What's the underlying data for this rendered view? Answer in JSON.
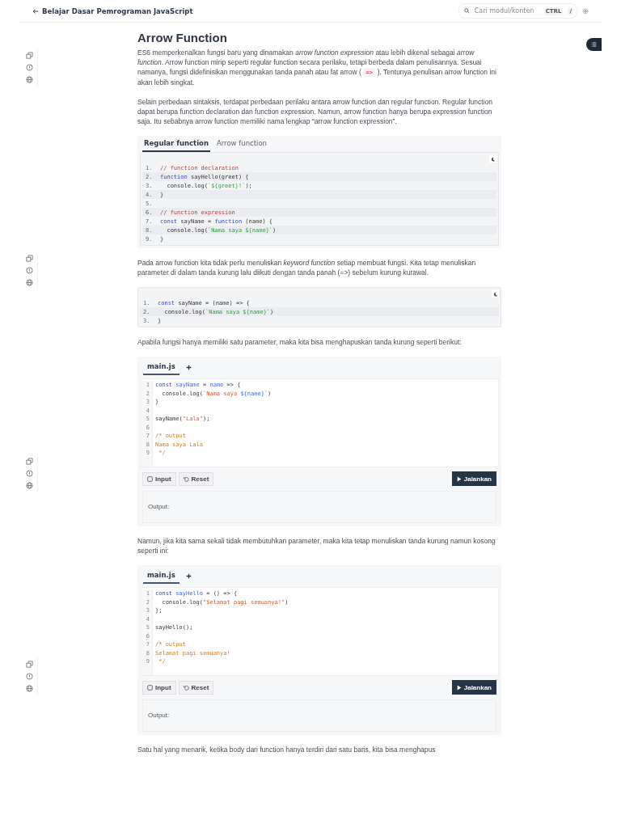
{
  "header": {
    "back_label": "Belajar Dasar Pemrograman JavaScript",
    "search": {
      "placeholder": "Cari modul/konten",
      "keys": [
        "CTRL",
        "/"
      ]
    }
  },
  "article": {
    "title": "Arrow Function",
    "blocks": [
      {
        "kind": "paragraph",
        "parts": [
          {
            "kind": "text",
            "text": "ES6 memperkenalkan fungsi baru yang dinamakan *arrow function expression* atau lebih dikenal sebagai *arrow function*. Arrow function mirip seperti regular function secara perilaku, tetapi berbeda dalam penulisannya. Sesuai namanya, fungsi didefinisikan menggunakan tanda panah atau fat arrow ( "
          },
          {
            "kind": "code",
            "text": "=>"
          },
          {
            "kind": "text",
            "text": " ). Tentunya penulisan arrow function ini akan lebih singkat."
          }
        ]
      },
      {
        "kind": "paragraph",
        "parts": [
          {
            "kind": "text",
            "text": "Selain perbedaan sintaksis, terdapat perbedaan perilaku antara arrow function dan regular function. Regular function dapat berupa function declaration dan function expression. Namun, arrow function hanya berupa expression function saja. Itu sebabnya arrow function memiliki nama lengkap “arrow function expression”."
          }
        ]
      },
      {
        "kind": "tabbed_code",
        "tabs": [
          {
            "label": "Regular function",
            "selected": true
          },
          {
            "label": "Arrow function",
            "selected": false
          }
        ],
        "lines": [
          {
            "num": "1.",
            "tokens": [
              {
                "kind": "comment",
                "text": "// function declaration"
              }
            ]
          },
          {
            "num": "2.",
            "tokens": [
              {
                "kind": "keyword",
                "text": "function"
              },
              {
                "kind": "plain",
                "text": " sayHello(greet) {"
              }
            ]
          },
          {
            "num": "3.",
            "tokens": [
              {
                "kind": "plain",
                "text": "  console.log("
              },
              {
                "kind": "string",
                "text": "`${greet}!`"
              },
              {
                "kind": "plain",
                "text": ");"
              }
            ]
          },
          {
            "num": "4.",
            "tokens": [
              {
                "kind": "plain",
                "text": "}"
              }
            ]
          },
          {
            "num": "5."
          },
          {
            "num": "6.",
            "tokens": [
              {
                "kind": "comment",
                "text": "// function expression"
              }
            ]
          },
          {
            "num": "7.",
            "tokens": [
              {
                "kind": "keyword",
                "text": "const"
              },
              {
                "kind": "plain",
                "text": " sayName = "
              },
              {
                "kind": "keyword",
                "text": "function"
              },
              {
                "kind": "plain",
                "text": " (name) {"
              }
            ]
          },
          {
            "num": "8.",
            "tokens": [
              {
                "kind": "plain",
                "text": "  console.log("
              },
              {
                "kind": "string",
                "text": "`Nama saya ${name}`"
              },
              {
                "kind": "plain",
                "text": ")"
              }
            ]
          },
          {
            "num": "9.",
            "tokens": [
              {
                "kind": "plain",
                "text": "}"
              }
            ]
          }
        ]
      },
      {
        "kind": "paragraph",
        "parts": [
          {
            "kind": "text",
            "text": "Pada arrow function kita tidak perlu menuliskan *keyword function* setiap membuat fungsi. Kita tetap menuliskan parameter di dalam tanda kurung lalu diikuti dengan tanda panah (=>) sebelum kurung kurawal."
          }
        ]
      },
      {
        "kind": "code",
        "lines": [
          {
            "num": "1.",
            "tokens": [
              {
                "kind": "keyword",
                "text": "const"
              },
              {
                "kind": "plain",
                "text": " sayName = (name) => {"
              }
            ]
          },
          {
            "num": "2.",
            "tokens": [
              {
                "kind": "plain",
                "text": "  console.log("
              },
              {
                "kind": "string",
                "text": "`Nama saya ${name}`"
              },
              {
                "kind": "plain",
                "text": ")"
              }
            ]
          },
          {
            "num": "3.",
            "tokens": [
              {
                "kind": "plain",
                "text": "}"
              }
            ]
          }
        ]
      },
      {
        "kind": "paragraph",
        "parts": [
          {
            "kind": "text",
            "text": "Apabila fungsi hanya memiliki satu parameter, maka kita bisa menghapuskan tanda kurung seperti berikut:"
          }
        ]
      },
      {
        "kind": "editor",
        "tabs": [
          {
            "label": "main.js",
            "selected": true
          }
        ],
        "lines": [
          {
            "num": "1",
            "tokens": [
              {
                "kind": "keyword",
                "text": "const "
              },
              {
                "kind": "name",
                "text": "sayName"
              },
              {
                "kind": "plain",
                "text": " = "
              },
              {
                "kind": "name",
                "text": "name"
              },
              {
                "kind": "plain",
                "text": " => {"
              }
            ]
          },
          {
            "num": "2",
            "tokens": [
              {
                "kind": "plain",
                "text": "  console.log("
              },
              {
                "kind": "literal",
                "text": "`Nama saya "
              },
              {
                "kind": "name",
                "text": "${name}"
              },
              {
                "kind": "literal",
                "text": "`"
              },
              {
                "kind": "plain",
                "text": ")"
              }
            ]
          },
          {
            "num": "3",
            "tokens": [
              {
                "kind": "plain",
                "text": "}"
              }
            ]
          },
          {
            "num": "4"
          },
          {
            "num": "5",
            "tokens": [
              {
                "kind": "plain",
                "text": "sayName("
              },
              {
                "kind": "literal",
                "text": "\"Lala\""
              },
              {
                "kind": "plain",
                "text": ");"
              }
            ]
          },
          {
            "num": "6"
          },
          {
            "num": "7",
            "tokens": [
              {
                "kind": "note",
                "text": "/* output"
              }
            ]
          },
          {
            "num": "8",
            "tokens": [
              {
                "kind": "note",
                "text": "Nama saya Lala"
              }
            ]
          },
          {
            "num": "9",
            "tokens": [
              {
                "kind": "note",
                "text": " */"
              }
            ]
          }
        ],
        "input_label": "Input",
        "reset_label": "Reset",
        "run_label": "Jalankan",
        "output_label": "Output:"
      },
      {
        "kind": "paragraph",
        "parts": [
          {
            "kind": "text",
            "text": "Namun, jika kita sama sekali tidak membutuhkan parameter, maka kita tetap menuliskan tanda kurung namun kosong seperti ini:"
          }
        ]
      },
      {
        "kind": "editor",
        "tabs": [
          {
            "label": "main.js",
            "selected": true
          }
        ],
        "lines": [
          {
            "num": "1",
            "tokens": [
              {
                "kind": "keyword",
                "text": "const "
              },
              {
                "kind": "name",
                "text": "sayHello"
              },
              {
                "kind": "plain",
                "text": " = () => {"
              }
            ]
          },
          {
            "num": "2",
            "tokens": [
              {
                "kind": "plain",
                "text": "  console.log("
              },
              {
                "kind": "literal",
                "text": "\"Selamat pagi semuanya!\""
              },
              {
                "kind": "plain",
                "text": ")"
              }
            ]
          },
          {
            "num": "3",
            "tokens": [
              {
                "kind": "plain",
                "text": "};"
              }
            ]
          },
          {
            "num": "4"
          },
          {
            "num": "5",
            "tokens": [
              {
                "kind": "plain",
                "text": "sayHello();"
              }
            ]
          },
          {
            "num": "6"
          },
          {
            "num": "7",
            "tokens": [
              {
                "kind": "note",
                "text": "/* output"
              }
            ]
          },
          {
            "num": "8",
            "tokens": [
              {
                "kind": "note",
                "text": "Selamat pagi semuanya!"
              }
            ]
          },
          {
            "num": "9",
            "tokens": [
              {
                "kind": "note",
                "text": " */"
              }
            ]
          }
        ],
        "input_label": "Input",
        "reset_label": "Reset",
        "run_label": "Jalankan",
        "output_label": "Output:"
      },
      {
        "kind": "paragraph",
        "parts": [
          {
            "kind": "text",
            "text": "Satu hal yang menarik, ketika body dari function hanya terdiri dari satu baris, kita bisa menghapus"
          }
        ]
      }
    ]
  }
}
